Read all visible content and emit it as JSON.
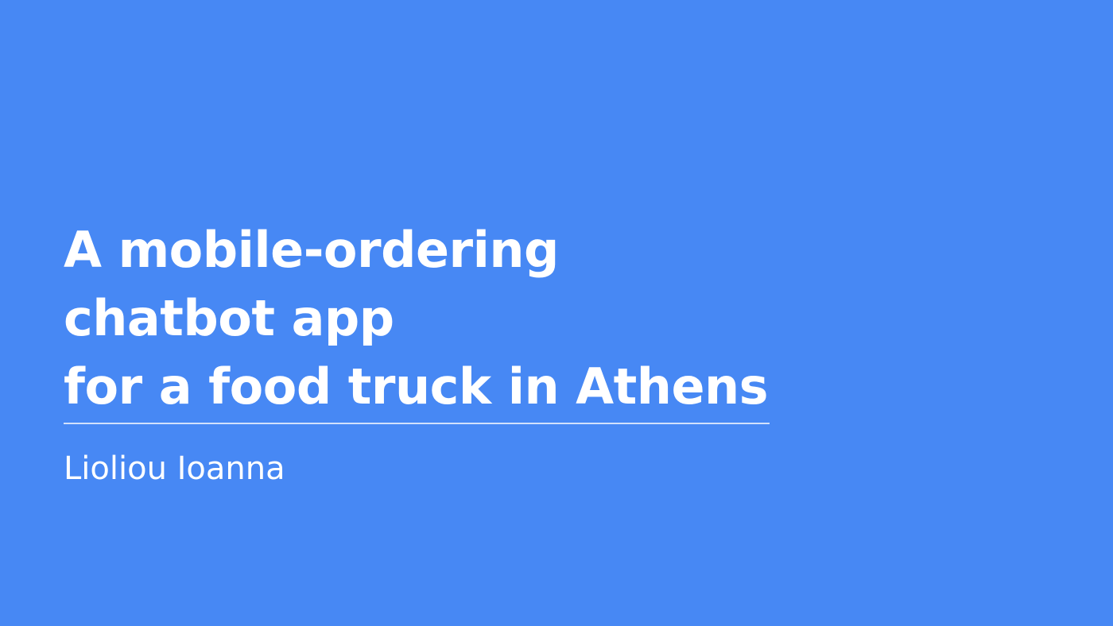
{
  "slide": {
    "background_color": "#4788F4",
    "text_color": "#FFFFFF",
    "title_lines": [
      "A mobile-ordering",
      "chatbot app",
      "for a food truck in Athens"
    ],
    "subtitle": "Lioliou Ioanna"
  }
}
